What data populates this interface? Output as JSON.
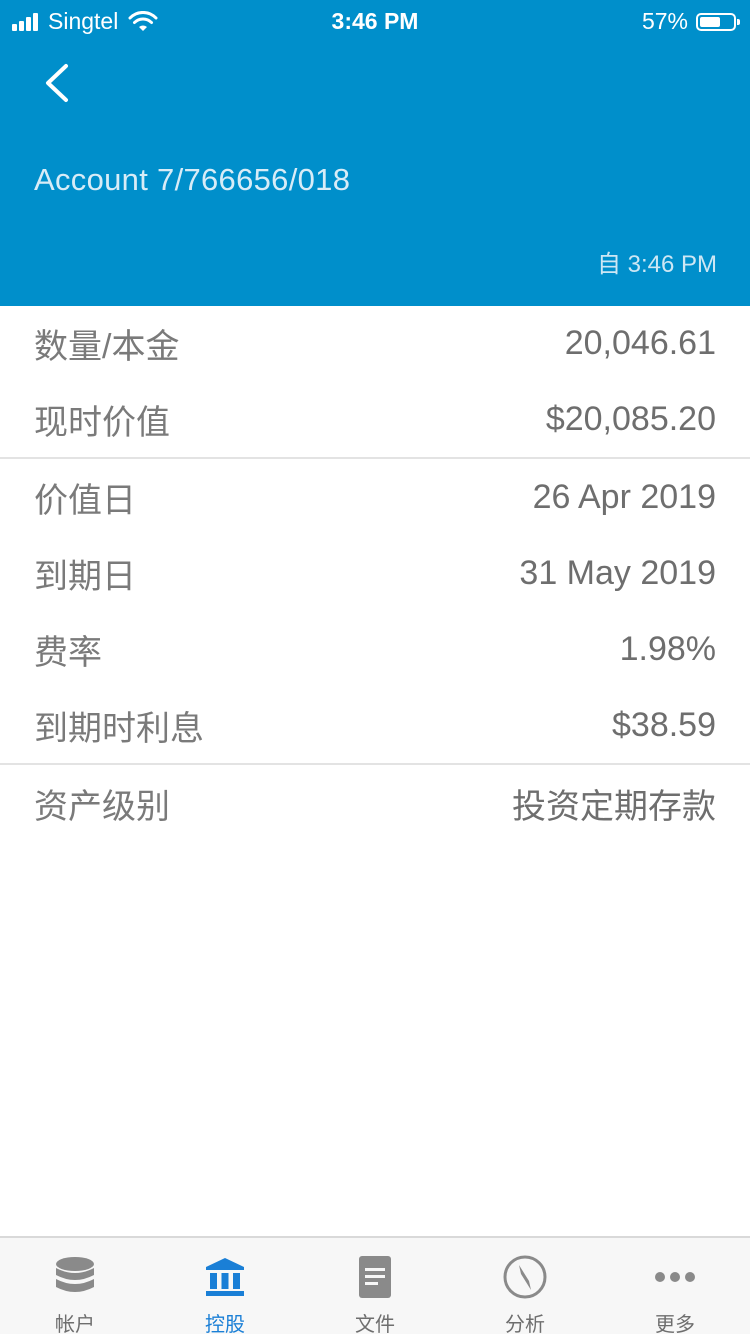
{
  "status_bar": {
    "carrier": "Singtel",
    "time": "3:46 PM",
    "battery": "57%",
    "battery_level": 0.57
  },
  "header": {
    "back_icon": "chevron-left-icon",
    "account_title": "Account 7/766656/018",
    "as_of": "自 3:46 PM"
  },
  "details": {
    "group1": [
      {
        "label": "数量/本金",
        "value": "20,046.61"
      },
      {
        "label": "现时价值",
        "value": "$20,085.20"
      }
    ],
    "group2": [
      {
        "label": "价值日",
        "value": "26 Apr 2019"
      },
      {
        "label": "到期日",
        "value": "31 May 2019"
      },
      {
        "label": "费率",
        "value": "1.98%"
      },
      {
        "label": "到期时利息",
        "value": "$38.59"
      }
    ],
    "group3": [
      {
        "label": "资产级别",
        "value": "投资定期存款"
      }
    ]
  },
  "tabbar": {
    "tabs": [
      {
        "label": "帐户",
        "icon": "database-icon",
        "active": false
      },
      {
        "label": "控股",
        "icon": "bank-icon",
        "active": true
      },
      {
        "label": "文件",
        "icon": "document-icon",
        "active": false
      },
      {
        "label": "分析",
        "icon": "compass-icon",
        "active": false
      },
      {
        "label": "更多",
        "icon": "more-icon",
        "active": false
      }
    ]
  },
  "colors": {
    "header_bg": "#008fcb",
    "active_tab": "#1a7fd6",
    "inactive_tab": "#8a8a8a"
  }
}
